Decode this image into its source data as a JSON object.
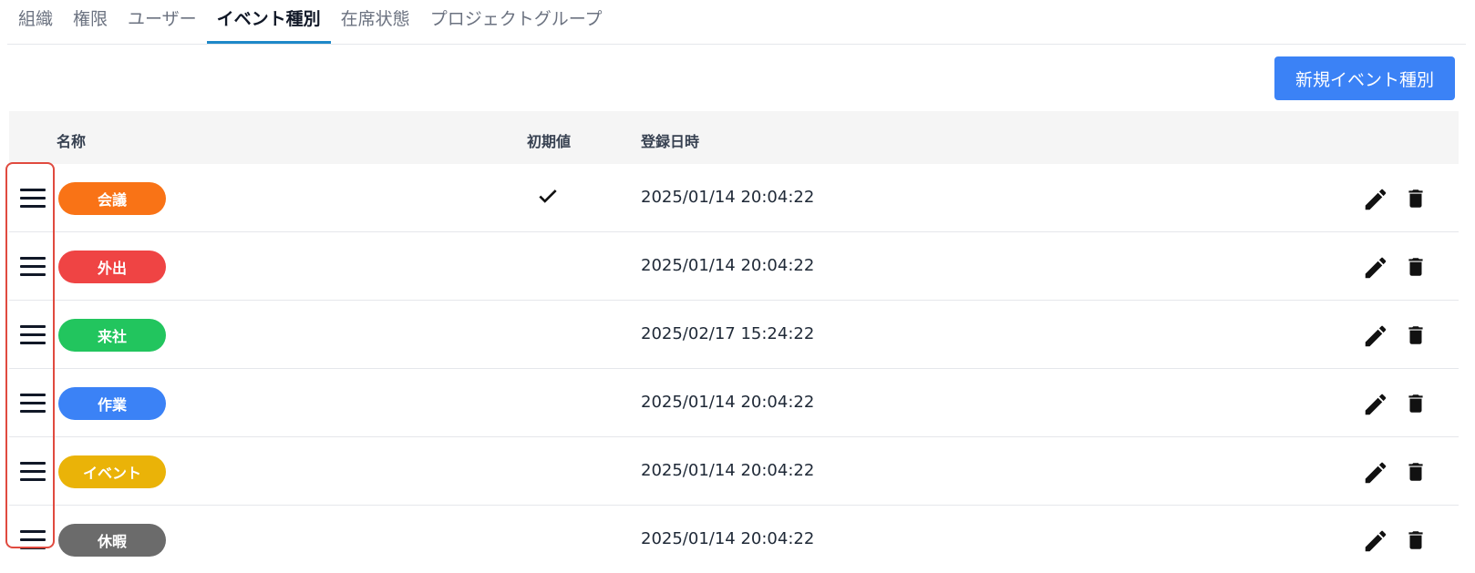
{
  "tabs": [
    {
      "label": "組織",
      "active": false
    },
    {
      "label": "権限",
      "active": false
    },
    {
      "label": "ユーザー",
      "active": false
    },
    {
      "label": "イベント種別",
      "active": true
    },
    {
      "label": "在席状態",
      "active": false
    },
    {
      "label": "プロジェクトグループ",
      "active": false
    }
  ],
  "new_button_label": "新規イベント種別",
  "table": {
    "headers": {
      "name": "名称",
      "default": "初期値",
      "registered_at": "登録日時"
    },
    "rows": [
      {
        "name": "会議",
        "color": "#f97316",
        "is_default": true,
        "registered_at": "2025/01/14 20:04:22"
      },
      {
        "name": "外出",
        "color": "#ef4444",
        "is_default": false,
        "registered_at": "2025/01/14 20:04:22"
      },
      {
        "name": "来社",
        "color": "#22c55e",
        "is_default": false,
        "registered_at": "2025/02/17 15:24:22"
      },
      {
        "name": "作業",
        "color": "#3b82f6",
        "is_default": false,
        "registered_at": "2025/01/14 20:04:22"
      },
      {
        "name": "イベント",
        "color": "#eab308",
        "is_default": false,
        "registered_at": "2025/01/14 20:04:22"
      },
      {
        "name": "休暇",
        "color": "#6b6b6b",
        "is_default": false,
        "registered_at": "2025/01/14 20:04:22"
      }
    ]
  },
  "icons": {
    "drag": "drag-handle-icon",
    "check": "check-icon",
    "edit": "pencil-icon",
    "delete": "trash-icon"
  },
  "colors": {
    "accent": "#3b82f6",
    "active_tab_underline": "#1e88c8",
    "highlight_border": "#e04a3f"
  }
}
